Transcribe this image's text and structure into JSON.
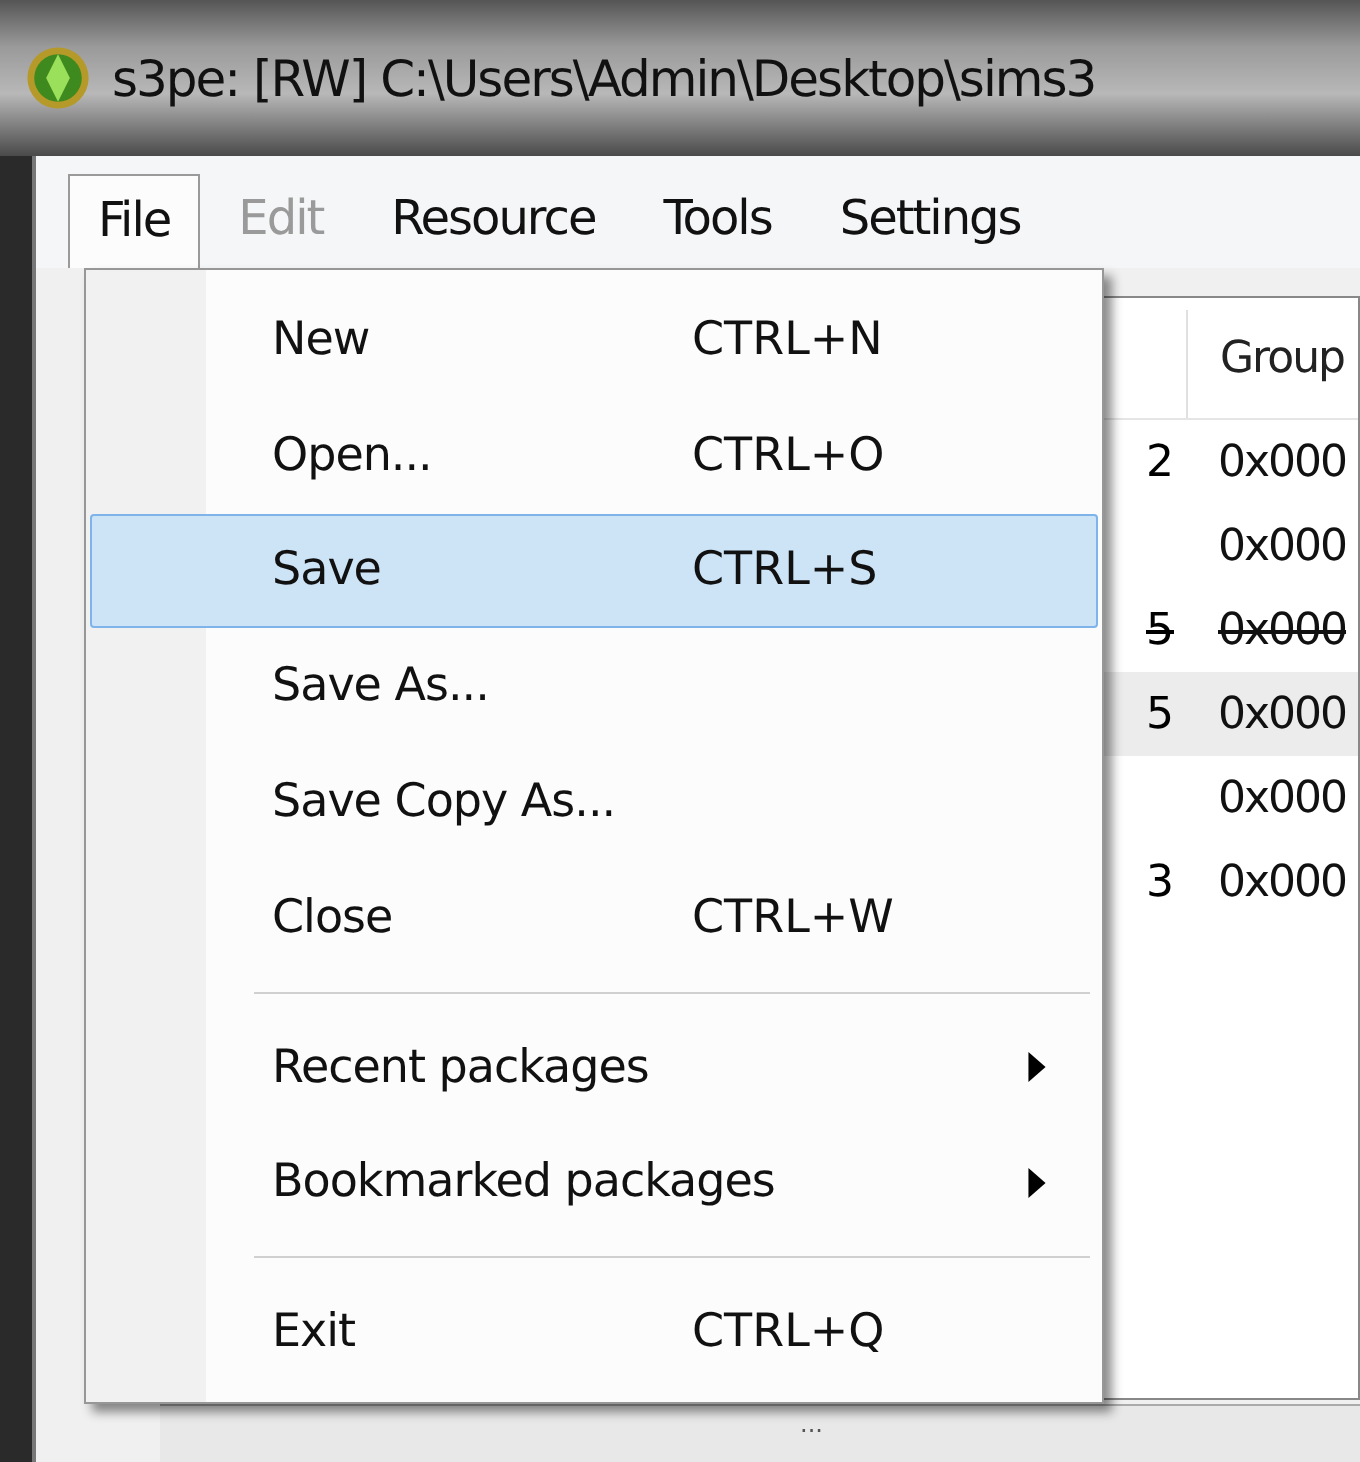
{
  "window": {
    "title": "s3pe: [RW] C:\\Users\\Admin\\Desktop\\sims3"
  },
  "menubar": [
    {
      "label": "File",
      "selected": true,
      "disabled": false
    },
    {
      "label": "Edit",
      "selected": false,
      "disabled": true
    },
    {
      "label": "Resource",
      "selected": false,
      "disabled": false
    },
    {
      "label": "Tools",
      "selected": false,
      "disabled": false
    },
    {
      "label": "Settings",
      "selected": false,
      "disabled": false
    }
  ],
  "file_menu": [
    {
      "kind": "item",
      "label": "New",
      "shortcut": "CTRL+N",
      "selected": false
    },
    {
      "kind": "item",
      "label": "Open...",
      "shortcut": "CTRL+O",
      "selected": false
    },
    {
      "kind": "item",
      "label": "Save",
      "shortcut": "CTRL+S",
      "selected": true
    },
    {
      "kind": "item",
      "label": "Save As...",
      "selected": false
    },
    {
      "kind": "item",
      "label": "Save Copy As...",
      "selected": false
    },
    {
      "kind": "item",
      "label": "Close",
      "shortcut": "CTRL+W",
      "selected": false
    },
    {
      "kind": "separator"
    },
    {
      "kind": "submenu",
      "label": "Recent packages",
      "selected": false
    },
    {
      "kind": "submenu",
      "label": "Bookmarked packages",
      "selected": false
    },
    {
      "kind": "separator"
    },
    {
      "kind": "item",
      "label": "Exit",
      "shortcut": "CTRL+Q",
      "selected": false
    }
  ],
  "table": {
    "columns": [
      "Group"
    ],
    "rows": [
      {
        "column_1": "2",
        "group": "0x000",
        "deleted": false,
        "selected": false
      },
      {
        "group": "0x000",
        "deleted": false,
        "selected": false
      },
      {
        "column_1": "5",
        "group": "0x000",
        "deleted": true,
        "selected": false
      },
      {
        "column_1": "5",
        "group": "0x000",
        "deleted": false,
        "selected": true
      },
      {
        "group": "0x000",
        "deleted": false,
        "selected": false
      },
      {
        "column_1": "3",
        "group": "0x000",
        "deleted": false,
        "selected": false
      }
    ]
  },
  "status_bar": {
    "text": "..."
  }
}
